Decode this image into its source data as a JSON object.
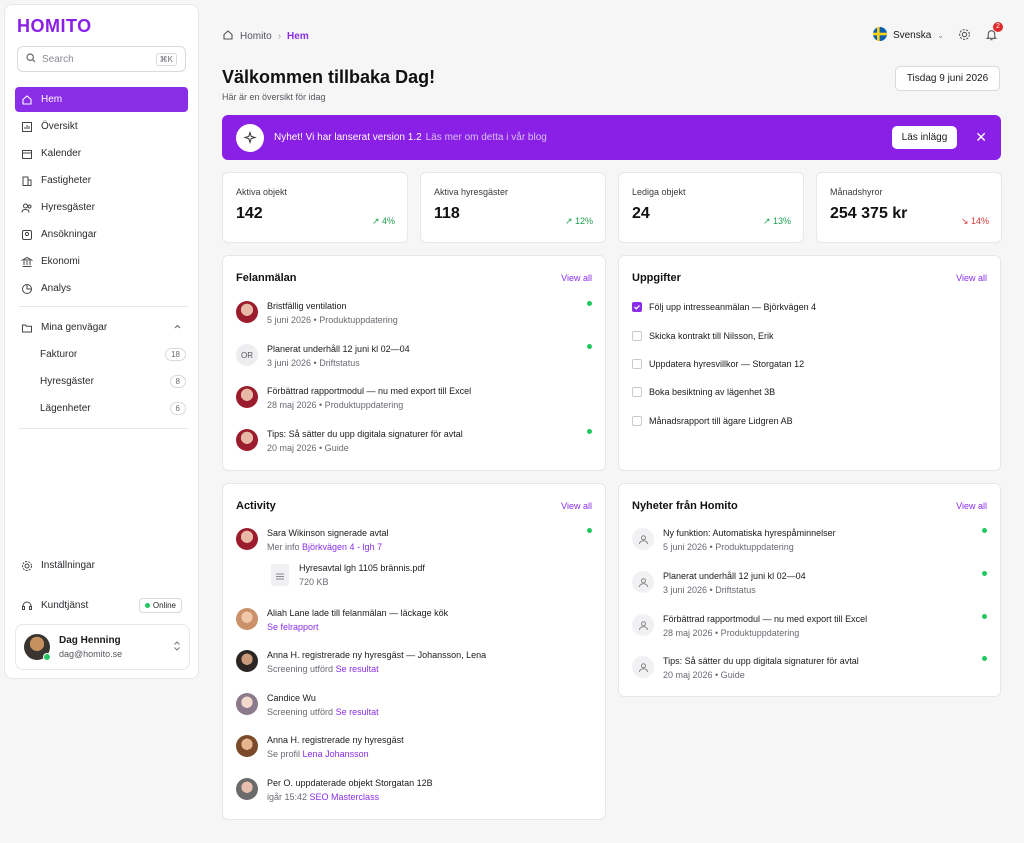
{
  "brand": {
    "logo_text": "HOMITO",
    "accent": "#8a2ee8"
  },
  "search": {
    "placeholder": "Search",
    "shortcut": "⌘K"
  },
  "sidebar": {
    "items": [
      {
        "label": "Hem",
        "icon": "home-icon"
      },
      {
        "label": "Översikt",
        "icon": "chart-icon"
      },
      {
        "label": "Kalender",
        "icon": "calendar-icon"
      },
      {
        "label": "Fastigheter",
        "icon": "building-icon"
      },
      {
        "label": "Hyresgäster",
        "icon": "users-icon"
      },
      {
        "label": "Ansökningar",
        "icon": "id-card-icon"
      },
      {
        "label": "Ekonomi",
        "icon": "bank-icon"
      },
      {
        "label": "Analys",
        "icon": "pie-icon"
      }
    ],
    "shortcuts": {
      "label": "Mina genvägar",
      "items": [
        {
          "label": "Fakturor",
          "count": "18"
        },
        {
          "label": "Hyresgäster",
          "count": "8"
        },
        {
          "label": "Lägenheter",
          "count": "6"
        }
      ]
    },
    "settings_label": "Inställningar",
    "support_label": "Kundtjänst",
    "online_label": "Online",
    "user": {
      "name": "Dag Henning",
      "email": "dag@homito.se"
    }
  },
  "breadcrumb": {
    "root": "Homito",
    "current": "Hem"
  },
  "topbar": {
    "language": "Svenska",
    "notification_count": "2"
  },
  "header": {
    "title": "Välkommen tillbaka Dag!",
    "subtitle": "Här är en översikt för idag",
    "date": "Tisdag 9 juni 2026"
  },
  "banner": {
    "title": "Nyhet! Vi har lanserat version 1.2",
    "text": "Läs mer om detta i vår blog",
    "button": "Läs inlägg"
  },
  "stats": [
    {
      "label": "Aktiva objekt",
      "value": "142",
      "trend": "4%",
      "direction": "up"
    },
    {
      "label": "Aktiva hyresgäster",
      "value": "118",
      "trend": "12%",
      "direction": "up"
    },
    {
      "label": "Lediga objekt",
      "value": "24",
      "trend": "13%",
      "direction": "up"
    },
    {
      "label": "Månadshyror",
      "value": "254 375 kr",
      "trend": "14%",
      "direction": "down"
    }
  ],
  "felanmalan": {
    "title": "Felanmälan",
    "view_all": "View all",
    "items": [
      {
        "title": "Bristfällig ventilation",
        "meta": "5 juni 2026 • Produktuppdatering"
      },
      {
        "title": "Planerat underhåll 12 juni kl 02—04",
        "meta": "3 juni 2026 • Driftstatus",
        "initials": "OR"
      },
      {
        "title": "Förbättrad rapportmodul — nu med export till Excel",
        "meta": "28 maj 2026 • Produktuppdatering"
      },
      {
        "title": "Tips: Så sätter du upp digitala signaturer för avtal",
        "meta": "20 maj 2026 • Guide"
      }
    ]
  },
  "uppgifter": {
    "title": "Uppgifter",
    "view_all": "View all",
    "items": [
      {
        "label": "Följ upp intresseanmälan — Björkvägen 4",
        "checked": true
      },
      {
        "label": "Skicka kontrakt till Nilsson, Erik",
        "checked": false
      },
      {
        "label": "Uppdatera hyresvillkor — Storgatan 12",
        "checked": false
      },
      {
        "label": "Boka besiktning av lägenhet 3B",
        "checked": false
      },
      {
        "label": "Månadsrapport till ägare Lidgren AB",
        "checked": false
      }
    ]
  },
  "activity": {
    "title": "Activity",
    "view_all": "View all",
    "items": [
      {
        "title": "Sara Wikinson signerade avtal",
        "meta": "Mer info",
        "link": "Björkvägen 4 - lgh 7"
      },
      {
        "title": "Aliah Lane lade till felanmälan — läckage kök",
        "meta": "",
        "link": "Se felrapport"
      },
      {
        "title": "Anna H. registrerade ny hyresgäst — Johansson, Lena",
        "meta": "Screening utförd",
        "link": "Se resultat"
      },
      {
        "title": "Candice Wu",
        "meta": "Screening utförd",
        "link": "Se resultat"
      },
      {
        "title": "Anna H. registrerade ny hyresgäst",
        "meta": "Se profil",
        "link": "Lena Johansson"
      },
      {
        "title": "Per O. uppdaterade objekt Storgatan 12B",
        "meta": "igår 15:42",
        "link": "SEO Masterclass"
      }
    ],
    "file": {
      "name": "Hyresavtal lgh 1105 brännis.pdf",
      "size": "720 KB"
    }
  },
  "nyheter": {
    "title": "Nyheter från Homito",
    "view_all": "View all",
    "items": [
      {
        "title": "Ny funktion: Automatiska hyrespåminnelser",
        "meta": "5 juni 2026 • Produktuppdatering"
      },
      {
        "title": "Planerat underhåll 12 juni kl 02—04",
        "meta": "3 juni 2026 • Driftstatus"
      },
      {
        "title": "Förbättrad rapportmodul — nu med export till Excel",
        "meta": "28 maj 2026 • Produktuppdatering"
      },
      {
        "title": "Tips: Så sätter du upp digitala signaturer för avtal",
        "meta": "20 maj 2026 • Guide"
      }
    ]
  }
}
